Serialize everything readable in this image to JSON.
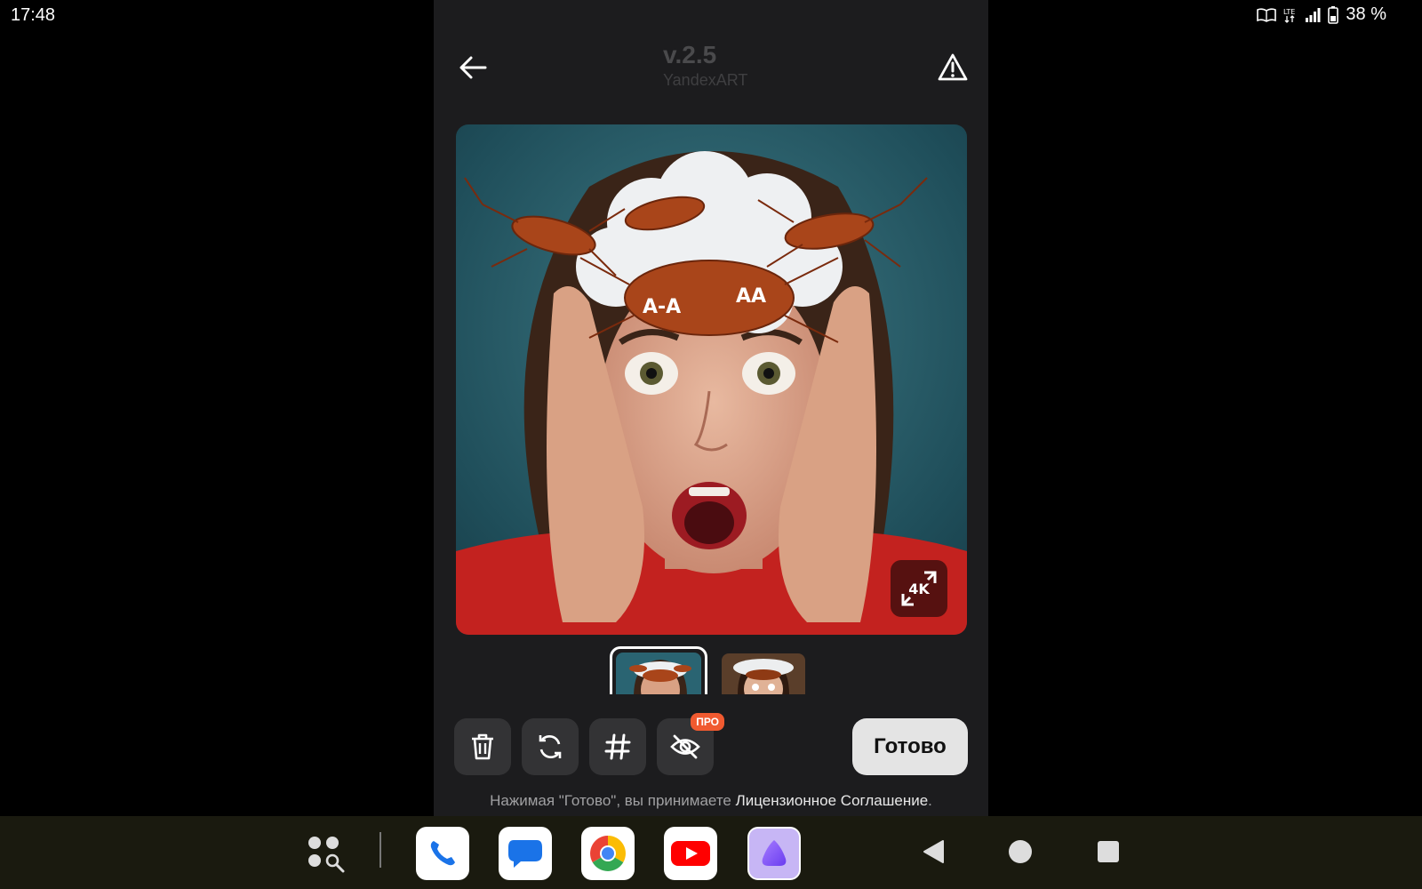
{
  "status": {
    "time": "17:48",
    "battery": "38 %",
    "icons": [
      "reader-mode-icon",
      "lte-icon",
      "signal-icon",
      "battery-icon"
    ]
  },
  "header": {
    "version": "v.2.5",
    "model": "YandexART",
    "icons": [
      "back-arrow-icon",
      "warning-icon"
    ]
  },
  "image": {
    "upscale_label": "4K"
  },
  "toolbar": {
    "pro_badge": "ПРО",
    "done_label": "Готово",
    "icons": [
      "trash-icon",
      "regenerate-icon",
      "hashtag-icon",
      "hide-eye-icon"
    ]
  },
  "legal": {
    "prefix": "Нажимая \"Готово\", вы принимаете ",
    "link": "Лицензионное Соглашение",
    "suffix": "."
  },
  "dock": {
    "apps": [
      "phone-app-icon",
      "messages-app-icon",
      "chrome-app-icon",
      "youtube-app-icon",
      "alice-app-icon"
    ],
    "nav": [
      "back-nav-icon",
      "home-nav-icon",
      "recents-nav-icon"
    ]
  },
  "colors": {
    "panel_bg": "#1c1c1e",
    "tool_bg": "#333335",
    "pro": "#f05a30",
    "done_bg": "#e4e4e4"
  }
}
